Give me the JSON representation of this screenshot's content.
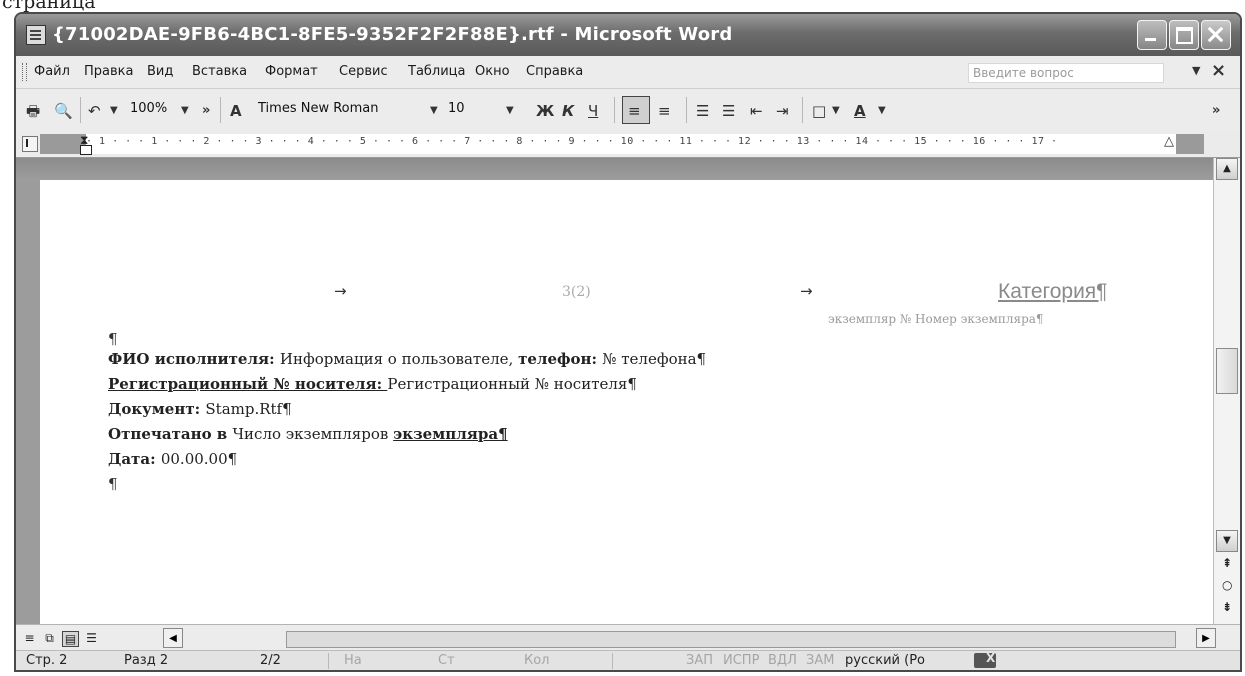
{
  "top_stub_text": "страница",
  "window": {
    "title": "{71002DAE-9FB6-4BC1-8FE5-9352F2F2F88E}.rtf - Microsoft Word"
  },
  "menu": {
    "items": [
      "Файл",
      "Правка",
      "Вид",
      "Вставка",
      "Формат",
      "Сервис",
      "Таблица",
      "Окно",
      "Справка"
    ],
    "ask_placeholder": "Введите вопрос"
  },
  "toolbar": {
    "zoom": "100%",
    "font_name": "Times New Roman",
    "font_size": "10",
    "bold_label": "Ж",
    "italic_label": "К",
    "underline_label": "Ч"
  },
  "ruler": {
    "scale": "· 1 · · · 1 · · · 2 · · · 3 · · · 4 · · · 5 · · · 6 · · · 7 · · · 8 · · · 9 · · · 10 · · · 11 · · · 12 · · · 13 · · · 14 · · · 15 · · · 16 · · · 17 ·"
  },
  "document": {
    "header_number": "3(2)",
    "category": "Категория¶",
    "copy_note": "экземпляр № Номер экземпляра¶",
    "pilcrow_top": "¶",
    "line1_bold_a": "ФИО исполнителя: ",
    "line1_text": "Информация о пользователе, ",
    "line1_bold_b": "телефон: ",
    "line1_tail": "№ телефона¶",
    "line2_bold": "Регистрационный № носителя: ",
    "line2_text": "Регистрационный № носителя¶",
    "line3_bold": "Документ: ",
    "line3_text": "Stamp.Rtf¶",
    "line4_bold": "Отпечатано в ",
    "line4_text": "Число экземпляров ",
    "line4_bold_b": "экземпляра¶",
    "line5_bold": "Дата: ",
    "line5_text": "00.00.00¶",
    "pilcrow_bottom": "¶"
  },
  "status": {
    "page": "Стр. 2",
    "section": "Разд 2",
    "pages": "2/2",
    "at": "На",
    "line": "Ст",
    "col": "Кол",
    "rec": "ЗАП",
    "trk": "ИСПР",
    "ext": "ВДЛ",
    "ovr": "ЗАМ",
    "language": "русский (Ро"
  }
}
